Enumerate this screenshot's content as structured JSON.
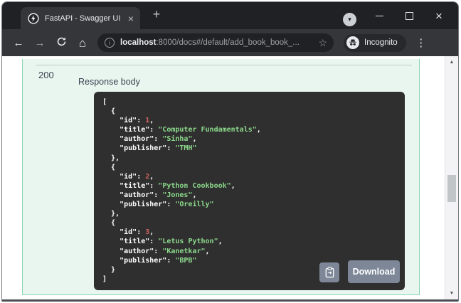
{
  "browser": {
    "tab": {
      "title": "FastAPI - Swagger UI"
    },
    "address": {
      "host": "localhost",
      "path": ":8000/docs#/default/add_book_book_...",
      "incognito_label": "Incognito"
    }
  },
  "response": {
    "code": "200",
    "body_label": "Response body",
    "download_label": "Download",
    "books": [
      {
        "id": 1,
        "title": "Computer Fundamentals",
        "author": "Sinha",
        "publisher": "TMH"
      },
      {
        "id": 2,
        "title": "Python Cookbook",
        "author": "Jones",
        "publisher": "Oreilly"
      },
      {
        "id": 3,
        "title": "Letus Python",
        "author": "Kanetkar",
        "publisher": "BPB"
      }
    ]
  },
  "icons": {
    "close": "×",
    "plus": "+",
    "chevron_down": "▾",
    "back": "←",
    "forward": "→",
    "home": "⌂",
    "star": "☆",
    "kebab": "⋮",
    "info_letter": "i",
    "triangle_up": "▲",
    "triangle_down": "▼"
  },
  "colors": {
    "chrome_dark": "#202124",
    "chrome_mid": "#35363a",
    "text_light": "#e8eaed",
    "text_dim": "#9aa0a6",
    "mint_bg": "#e9f6ef",
    "mint_border": "#8bd6b4",
    "label_color": "#3b4151",
    "code_bg": "#2f2f2f",
    "code_text": "#ffffff",
    "code_string": "#8cd98c",
    "code_number": "#d36363",
    "button_bg": "#7d8797"
  }
}
